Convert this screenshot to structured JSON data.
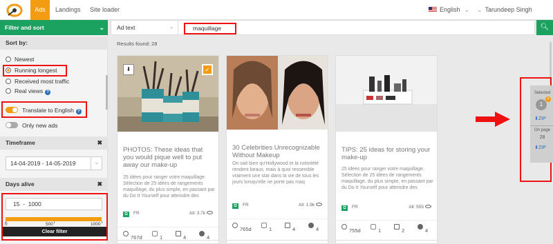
{
  "nav": {
    "tabs": [
      "Ads",
      "Landings",
      "Site loader"
    ],
    "language": "English",
    "user": "Tarundeep Singh"
  },
  "filter_bar": {
    "header": "Filter and sort",
    "ad_type": "Ad text",
    "search_value": "maquillage"
  },
  "sidebar": {
    "sort_title": "Sort by:",
    "sort_options": [
      "Newest",
      "Running longest",
      "Received most traffic",
      "Real views"
    ],
    "selected_sort": "Running longest",
    "translate_label": "Translate to English",
    "translate_on": true,
    "new_ads_label": "Only new ads",
    "new_ads_on": false,
    "timeframe_title": "Timeframe",
    "timeframe_value": "14-04-2019 - 14-05-2019",
    "days_alive_title": "Days alive",
    "days_min": "15",
    "days_sep": "-",
    "days_max": "1000",
    "slider_labels": [
      "0",
      "500",
      "1000"
    ],
    "clear_label": "Clear filter"
  },
  "main": {
    "results": "Results found: 28",
    "cards": [
      {
        "title": "PHOTOS: These ideas that you would pique well to put away our make-up",
        "desc": "25 idées pour ranger votre maquillage. Sélection de 25 idées de rangements maquillage, du plus simple, en passant par du Do It Yourself pour atteindre des",
        "country": "FR",
        "all": "All: 3.7k",
        "days": "767d",
        "hexes": "1",
        "screens": "4",
        "globe": "4"
      },
      {
        "title": "30 Celebrities Unrecognizable Without Makeup",
        "desc": "On sait bien qu'Hollywood et la notoriété rendent beaux, mais à quoi ressemble vraiment une star dans la vie de tous les jours lorsqu'elle ne porte pas maq",
        "country": "FR",
        "all": "All: 1.9k",
        "days": "765d",
        "hexes": "1",
        "screens": "4",
        "globe": "4"
      },
      {
        "title": "TIPS: 25 ideas for storing your make-up",
        "desc": "25 idées pour ranger votre maquillage. Sélection de 25 idées de rangements maquillage, du plus simple, en passant par du Do It Yourself pour atteindre des",
        "country": "FR",
        "all": "All: 555",
        "days": "755d",
        "hexes": "1",
        "screens": "2",
        "globe": "4"
      }
    ]
  },
  "right_panel": {
    "selected": "Selected",
    "count": "1",
    "zip": "ZIP",
    "on_page": "On page",
    "on_page_count": "28",
    "zip2": "ZIP"
  }
}
